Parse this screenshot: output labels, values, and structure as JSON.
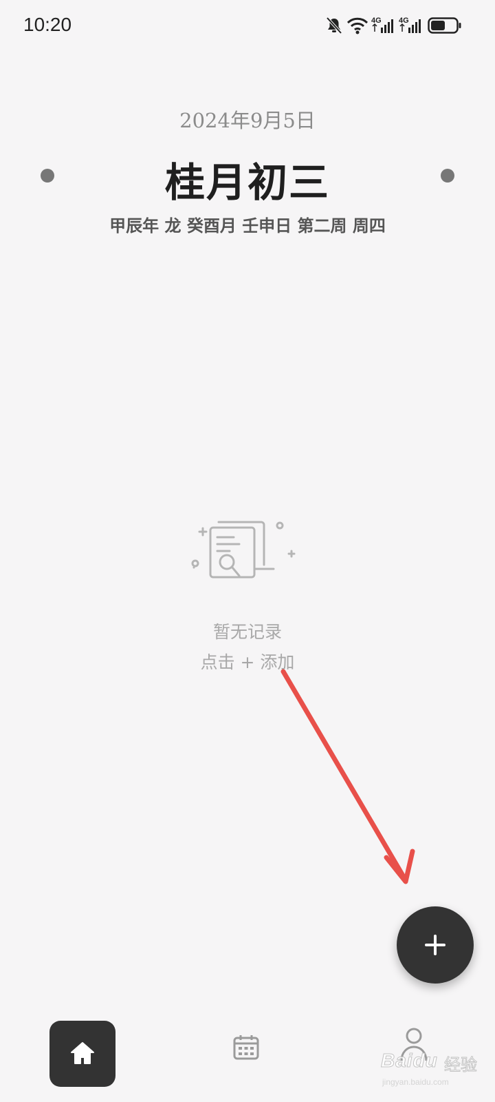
{
  "status_bar": {
    "time": "10:20",
    "icons": [
      "bell-muted-icon",
      "wifi-icon",
      "signal-4g-icon",
      "signal-4g-icon",
      "battery-icon"
    ],
    "network_labels": [
      "4G",
      "4G"
    ]
  },
  "header": {
    "date": "2024年9月5日",
    "lunar_title": "桂月初三",
    "ganzhi": "甲辰年 龙 癸酉月 壬申日 第二周 周四"
  },
  "empty_state": {
    "icon": "document-search-icon",
    "message": "暂无记录",
    "hint": "点击 + 添加"
  },
  "fab": {
    "icon": "plus-icon",
    "color": "#333333"
  },
  "bottom_nav": {
    "items": [
      {
        "name": "home",
        "icon": "home-icon",
        "active": true
      },
      {
        "name": "calendar",
        "icon": "calendar-icon",
        "active": false
      },
      {
        "name": "profile",
        "icon": "user-icon",
        "active": false
      }
    ]
  },
  "annotation": {
    "color": "#e8504a"
  },
  "watermark": {
    "logo": "Baidu",
    "cn": "经验",
    "url": "jingyan.baidu.com"
  },
  "colors": {
    "background": "#f6f5f6",
    "accent_dark": "#333333",
    "muted_text": "#a8a8a8"
  }
}
